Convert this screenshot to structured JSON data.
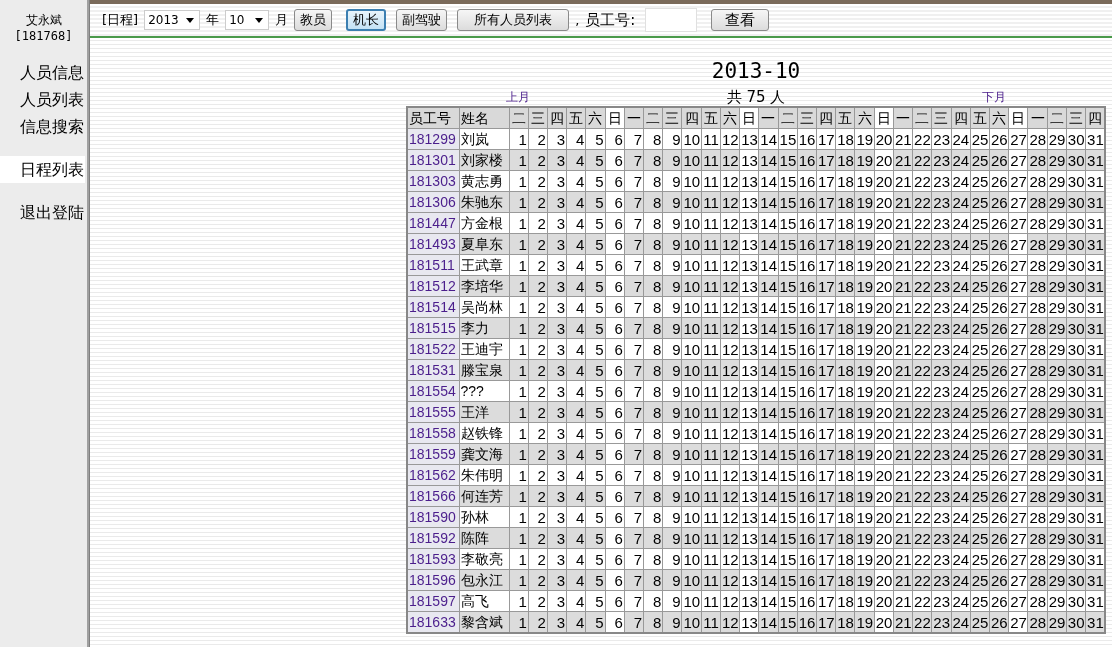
{
  "user": {
    "name": "艾永斌",
    "id": "[181768]"
  },
  "sidebar": {
    "groups": [
      [
        {
          "label": "人员信息",
          "selected": false
        },
        {
          "label": "人员列表",
          "selected": false
        },
        {
          "label": "信息搜索",
          "selected": false
        }
      ],
      [
        {
          "label": "日程列表",
          "selected": true
        }
      ],
      [
        {
          "label": "退出登陆",
          "selected": false
        }
      ]
    ]
  },
  "toolbar": {
    "prefix": "[日程]",
    "year": "2013",
    "year_unit": "年",
    "month": "10",
    "month_unit": "月",
    "buttons": [
      {
        "label": "教员",
        "selected": false
      },
      {
        "label": "机长",
        "selected": true
      },
      {
        "label": "副驾驶",
        "selected": false
      },
      {
        "label": "所有人员列表",
        "selected": false
      }
    ],
    "separator": ",",
    "staff_label": "员工号:",
    "search_button": "查看"
  },
  "schedule": {
    "title": "2013-10",
    "prev_link": "上月",
    "count": "共 75 人",
    "next_link": "下月",
    "columns": {
      "id": "员工号",
      "name": "姓名"
    },
    "days": [
      {
        "weekday": "二",
        "rest": false
      },
      {
        "weekday": "三",
        "rest": false
      },
      {
        "weekday": "四",
        "rest": false
      },
      {
        "weekday": "五",
        "rest": false
      },
      {
        "weekday": "六",
        "rest": false
      },
      {
        "weekday": "日",
        "rest": true
      },
      {
        "weekday": "一",
        "rest": false
      },
      {
        "weekday": "二",
        "rest": false
      },
      {
        "weekday": "三",
        "rest": false
      },
      {
        "weekday": "四",
        "rest": false
      },
      {
        "weekday": "五",
        "rest": false
      },
      {
        "weekday": "六",
        "rest": false
      },
      {
        "weekday": "日",
        "rest": true
      },
      {
        "weekday": "一",
        "rest": false
      },
      {
        "weekday": "二",
        "rest": false
      },
      {
        "weekday": "三",
        "rest": false
      },
      {
        "weekday": "四",
        "rest": false
      },
      {
        "weekday": "五",
        "rest": false
      },
      {
        "weekday": "六",
        "rest": false
      },
      {
        "weekday": "日",
        "rest": true
      },
      {
        "weekday": "一",
        "rest": false
      },
      {
        "weekday": "二",
        "rest": false
      },
      {
        "weekday": "三",
        "rest": false
      },
      {
        "weekday": "四",
        "rest": false
      },
      {
        "weekday": "五",
        "rest": false
      },
      {
        "weekday": "六",
        "rest": false
      },
      {
        "weekday": "日",
        "rest": true
      },
      {
        "weekday": "一",
        "rest": false
      },
      {
        "weekday": "二",
        "rest": false
      },
      {
        "weekday": "三",
        "rest": false
      },
      {
        "weekday": "四",
        "rest": false
      }
    ],
    "rows": [
      {
        "id": "181299",
        "name": "刘岚",
        "shaded": false,
        "cells": [
          "1",
          "2",
          "3",
          "4",
          "5",
          "6",
          "7",
          "8",
          "9",
          "10",
          "11",
          "12",
          "13",
          "14",
          "15",
          "16",
          "17",
          "18",
          "19",
          "20",
          "21",
          "22",
          "23",
          "24",
          "25",
          "26",
          "27",
          "28",
          "29",
          "30",
          "31"
        ]
      },
      {
        "id": "181301",
        "name": "刘家楼",
        "shaded": true,
        "cells": [
          "1",
          "2",
          "3",
          "4",
          "5",
          "6",
          "7",
          "8",
          "9",
          "10",
          "11",
          "12",
          "13",
          "14",
          "15",
          "16",
          "17",
          "18",
          "19",
          "20",
          "21",
          "22",
          "23",
          "24",
          "25",
          "26",
          "27",
          "28",
          "29",
          "30",
          "31"
        ]
      },
      {
        "id": "181303",
        "name": "黄志勇",
        "shaded": false,
        "cells": [
          "1",
          "2",
          "3",
          "4",
          "5",
          "6",
          "7",
          "8",
          "9",
          "10",
          "11",
          "12",
          "13",
          "14",
          "15",
          "16",
          "17",
          "18",
          "19",
          "20",
          "21",
          "22",
          "23",
          "24",
          "25",
          "26",
          "27",
          "28",
          "29",
          "30",
          "31"
        ]
      },
      {
        "id": "181306",
        "name": "朱驰东",
        "shaded": true,
        "cells": [
          "1",
          "2",
          "3",
          "4",
          "5",
          "6",
          "7",
          "8",
          "9",
          "10",
          "11",
          "12",
          "13",
          "14",
          "15",
          "16",
          "17",
          "18",
          "19",
          "20",
          "21",
          "22",
          "23",
          "24",
          "25",
          "26",
          "27",
          "28",
          "29",
          "30",
          "31"
        ]
      },
      {
        "id": "181447",
        "name": "方金根",
        "shaded": false,
        "cells": [
          "1",
          "2",
          "3",
          "4",
          "5",
          "6",
          "7",
          "8",
          "9",
          "10",
          "11",
          "12",
          "13",
          "14",
          "15",
          "16",
          "17",
          "18",
          "19",
          "20",
          "21",
          "22",
          "23",
          "24",
          "25",
          "26",
          "27",
          "28",
          "29",
          "30",
          "31"
        ]
      },
      {
        "id": "181493",
        "name": "夏阜东",
        "shaded": true,
        "cells": [
          "1",
          "2",
          "3",
          "4",
          "5",
          "6",
          "7",
          "8",
          "9",
          "10",
          "11",
          "12",
          "13",
          "14",
          "15",
          "16",
          "17",
          "18",
          "19",
          "20",
          "21",
          "22",
          "23",
          "24",
          "25",
          "26",
          "27",
          "28",
          "29",
          "30",
          "31"
        ]
      },
      {
        "id": "181511",
        "name": "王武章",
        "shaded": false,
        "cells": [
          "1",
          "2",
          "3",
          "4",
          "5",
          "6",
          "7",
          "8",
          "9",
          "10",
          "11",
          "12",
          "13",
          "14",
          "15",
          "16",
          "17",
          "18",
          "19",
          "20",
          "21",
          "22",
          "23",
          "24",
          "25",
          "26",
          "27",
          "28",
          "29",
          "30",
          "31"
        ]
      },
      {
        "id": "181512",
        "name": "李培华",
        "shaded": true,
        "cells": [
          "1",
          "2",
          "3",
          "4",
          "5",
          "6",
          "7",
          "8",
          "9",
          "10",
          "11",
          "12",
          "13",
          "14",
          "15",
          "16",
          "17",
          "18",
          "19",
          "20",
          "21",
          "22",
          "23",
          "24",
          "25",
          "26",
          "27",
          "28",
          "29",
          "30",
          "31"
        ]
      },
      {
        "id": "181514",
        "name": "吴尚林",
        "shaded": false,
        "cells": [
          "1",
          "2",
          "3",
          "4",
          "5",
          "6",
          "7",
          "8",
          "9",
          "10",
          "11",
          "12",
          "13",
          "14",
          "15",
          "16",
          "17",
          "18",
          "19",
          "20",
          "21",
          "22",
          "23",
          "24",
          "25",
          "26",
          "27",
          "28",
          "29",
          "30",
          "31"
        ]
      },
      {
        "id": "181515",
        "name": "李力",
        "shaded": true,
        "cells": [
          "1",
          "2",
          "3",
          "4",
          "5",
          "6",
          "7",
          "8",
          "9",
          "10",
          "11",
          "12",
          "13",
          "14",
          "15",
          "16",
          "17",
          "18",
          "19",
          "20",
          "21",
          "22",
          "23",
          "24",
          "25",
          "26",
          "27",
          "28",
          "29",
          "30",
          "31"
        ]
      },
      {
        "id": "181522",
        "name": "王迪宇",
        "shaded": false,
        "cells": [
          "1",
          "2",
          "3",
          "4",
          "5",
          "6",
          "7",
          "8",
          "9",
          "10",
          "11",
          "12",
          "13",
          "14",
          "15",
          "16",
          "17",
          "18",
          "19",
          "20",
          "21",
          "22",
          "23",
          "24",
          "25",
          "26",
          "27",
          "28",
          "29",
          "30",
          "31"
        ]
      },
      {
        "id": "181531",
        "name": "滕宝泉",
        "shaded": true,
        "cells": [
          "1",
          "2",
          "3",
          "4",
          "5",
          "6",
          "7",
          "8",
          "9",
          "10",
          "11",
          "12",
          "13",
          "14",
          "15",
          "16",
          "17",
          "18",
          "19",
          "20",
          "21",
          "22",
          "23",
          "24",
          "25",
          "26",
          "27",
          "28",
          "29",
          "30",
          "31"
        ]
      },
      {
        "id": "181554",
        "name": "???",
        "shaded": false,
        "cells": [
          "1",
          "2",
          "3",
          "4",
          "5",
          "6",
          "7",
          "8",
          "9",
          "10",
          "11",
          "12",
          "13",
          "14",
          "15",
          "16",
          "17",
          "18",
          "19",
          "20",
          "21",
          "22",
          "23",
          "24",
          "25",
          "26",
          "27",
          "28",
          "29",
          "30",
          "31"
        ]
      },
      {
        "id": "181555",
        "name": "王洋",
        "shaded": true,
        "cells": [
          "1",
          "2",
          "3",
          "4",
          "5",
          "6",
          "7",
          "8",
          "9",
          "10",
          "11",
          "12",
          "13",
          "14",
          "15",
          "16",
          "17",
          "18",
          "19",
          "20",
          "21",
          "22",
          "23",
          "24",
          "25",
          "26",
          "27",
          "28",
          "29",
          "30",
          "31"
        ]
      },
      {
        "id": "181558",
        "name": "赵铁锋",
        "shaded": false,
        "cells": [
          "1",
          "2",
          "3",
          "4",
          "5",
          "6",
          "7",
          "8",
          "9",
          "10",
          "11",
          "12",
          "13",
          "14",
          "15",
          "16",
          "17",
          "18",
          "19",
          "20",
          "21",
          "22",
          "23",
          "24",
          "25",
          "26",
          "27",
          "28",
          "29",
          "30",
          "31"
        ]
      },
      {
        "id": "181559",
        "name": "龚文海",
        "shaded": true,
        "cells": [
          "1",
          "2",
          "3",
          "4",
          "5",
          "6",
          "7",
          "8",
          "9",
          "10",
          "11",
          "12",
          "13",
          "14",
          "15",
          "16",
          "17",
          "18",
          "19",
          "20",
          "21",
          "22",
          "23",
          "24",
          "25",
          "26",
          "27",
          "28",
          "29",
          "30",
          "31"
        ]
      },
      {
        "id": "181562",
        "name": "朱伟明",
        "shaded": false,
        "cells": [
          "1",
          "2",
          "3",
          "4",
          "5",
          "6",
          "7",
          "8",
          "9",
          "10",
          "11",
          "12",
          "13",
          "14",
          "15",
          "16",
          "17",
          "18",
          "19",
          "20",
          "21",
          "22",
          "23",
          "24",
          "25",
          "26",
          "27",
          "28",
          "29",
          "30",
          "31"
        ]
      },
      {
        "id": "181566",
        "name": "何连芳",
        "shaded": true,
        "cells": [
          "1",
          "2",
          "3",
          "4",
          "5",
          "6",
          "7",
          "8",
          "9",
          "10",
          "11",
          "12",
          "13",
          "14",
          "15",
          "16",
          "17",
          "18",
          "19",
          "20",
          "21",
          "22",
          "23",
          "24",
          "25",
          "26",
          "27",
          "28",
          "29",
          "30",
          "31"
        ]
      },
      {
        "id": "181590",
        "name": "孙林",
        "shaded": false,
        "cells": [
          "1",
          "2",
          "3",
          "4",
          "5",
          "6",
          "7",
          "8",
          "9",
          "10",
          "11",
          "12",
          "13",
          "14",
          "15",
          "16",
          "17",
          "18",
          "19",
          "20",
          "21",
          "22",
          "23",
          "24",
          "25",
          "26",
          "27",
          "28",
          "29",
          "30",
          "31"
        ]
      },
      {
        "id": "181592",
        "name": "陈阵",
        "shaded": true,
        "cells": [
          "1",
          "2",
          "3",
          "4",
          "5",
          "6",
          "7",
          "8",
          "9",
          "10",
          "11",
          "12",
          "13",
          "14",
          "15",
          "16",
          "17",
          "18",
          "19",
          "20",
          "21",
          "22",
          "23",
          "24",
          "25",
          "26",
          "27",
          "28",
          "29",
          "30",
          "31"
        ]
      },
      {
        "id": "181593",
        "name": "李敬亮",
        "shaded": false,
        "cells": [
          "1",
          "2",
          "3",
          "4",
          "5",
          "6",
          "7",
          "8",
          "9",
          "10",
          "11",
          "12",
          "13",
          "14",
          "15",
          "16",
          "17",
          "18",
          "19",
          "20",
          "21",
          "22",
          "23",
          "24",
          "25",
          "26",
          "27",
          "28",
          "29",
          "30",
          "31"
        ]
      },
      {
        "id": "181596",
        "name": "包永江",
        "shaded": true,
        "cells": [
          "1",
          "2",
          "3",
          "4",
          "5",
          "6",
          "7",
          "8",
          "9",
          "10",
          "11",
          "12",
          "13",
          "14",
          "15",
          "16",
          "17",
          "18",
          "19",
          "20",
          "21",
          "22",
          "23",
          "24",
          "25",
          "26",
          "27",
          "28",
          "29",
          "30",
          "31"
        ]
      },
      {
        "id": "181597",
        "name": "高飞",
        "shaded": false,
        "cells": [
          "1",
          "2",
          "3",
          "4",
          "5",
          "6",
          "7",
          "8",
          "9",
          "10",
          "11",
          "12",
          "13",
          "14",
          "15",
          "16",
          "17",
          "18",
          "19",
          "20",
          "21",
          "22",
          "23",
          "24",
          "25",
          "26",
          "27",
          "28",
          "29",
          "30",
          "31"
        ]
      },
      {
        "id": "181633",
        "name": "黎含斌",
        "shaded": true,
        "cells": [
          "1",
          "2",
          "3",
          "4",
          "5",
          "6",
          "7",
          "8",
          "9",
          "10",
          "11",
          "12",
          "13",
          "14",
          "15",
          "16",
          "17",
          "18",
          "19",
          "20",
          "21",
          "22",
          "23",
          "24",
          "25",
          "26",
          "27",
          "28",
          "29",
          "30",
          "31"
        ]
      }
    ]
  }
}
